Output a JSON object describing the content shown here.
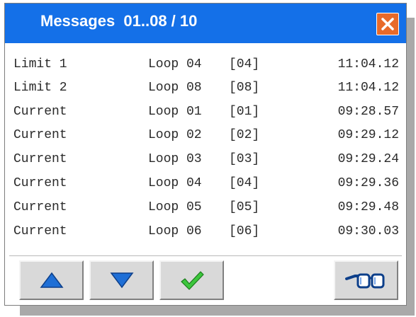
{
  "window": {
    "title": "Messages  01..08 / 10"
  },
  "messages": [
    {
      "type": "Limit 1",
      "loop": "Loop 04",
      "code": "[04]",
      "time": "11:04.12"
    },
    {
      "type": "Limit 2",
      "loop": "Loop 08",
      "code": "[08]",
      "time": "11:04.12"
    },
    {
      "type": "Current",
      "loop": "Loop 01",
      "code": "[01]",
      "time": "09:28.57"
    },
    {
      "type": "Current",
      "loop": "Loop 02",
      "code": "[02]",
      "time": "09:29.12"
    },
    {
      "type": "Current",
      "loop": "Loop 03",
      "code": "[03]",
      "time": "09:29.24"
    },
    {
      "type": "Current",
      "loop": "Loop 04",
      "code": "[04]",
      "time": "09:29.36"
    },
    {
      "type": "Current",
      "loop": "Loop 05",
      "code": "[05]",
      "time": "09:29.48"
    },
    {
      "type": "Current",
      "loop": "Loop 06",
      "code": "[06]",
      "time": "09:30.03"
    }
  ],
  "toolbar": {
    "buttons": [
      {
        "name": "scroll-up-button",
        "icon": "arrow-up-icon"
      },
      {
        "name": "scroll-down-button",
        "icon": "arrow-down-icon"
      },
      {
        "name": "acknowledge-button",
        "icon": "checkmark-icon"
      },
      {
        "name": "view-details-button",
        "icon": "glasses-icon"
      }
    ]
  },
  "colors": {
    "titlebar": "#1470e8",
    "close": "#e86a2a",
    "arrow": "#1f6fd6",
    "check": "#3cc63c"
  }
}
